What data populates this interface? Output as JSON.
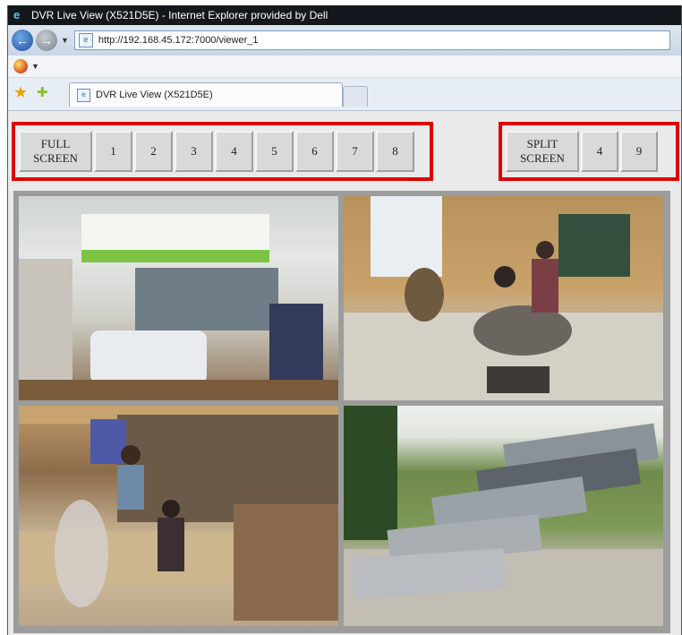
{
  "browser": {
    "title": "DVR Live View (X521D5E) - Internet Explorer provided by Dell",
    "address": "http://192.168.45.172:7000/viewer_1",
    "tab_title": "DVR Live View (X521D5E)"
  },
  "controls": {
    "full_screen_line1": "FULL",
    "full_screen_line2": "SCREEN",
    "channels": [
      "1",
      "2",
      "3",
      "4",
      "5",
      "6",
      "7",
      "8"
    ],
    "split_screen_line1": "SPLIT",
    "split_screen_line2": "SCREEN",
    "split_options": [
      "4",
      "9"
    ]
  },
  "colors": {
    "highlight_border": "#e00000",
    "grid_background": "#9c9c9c"
  }
}
